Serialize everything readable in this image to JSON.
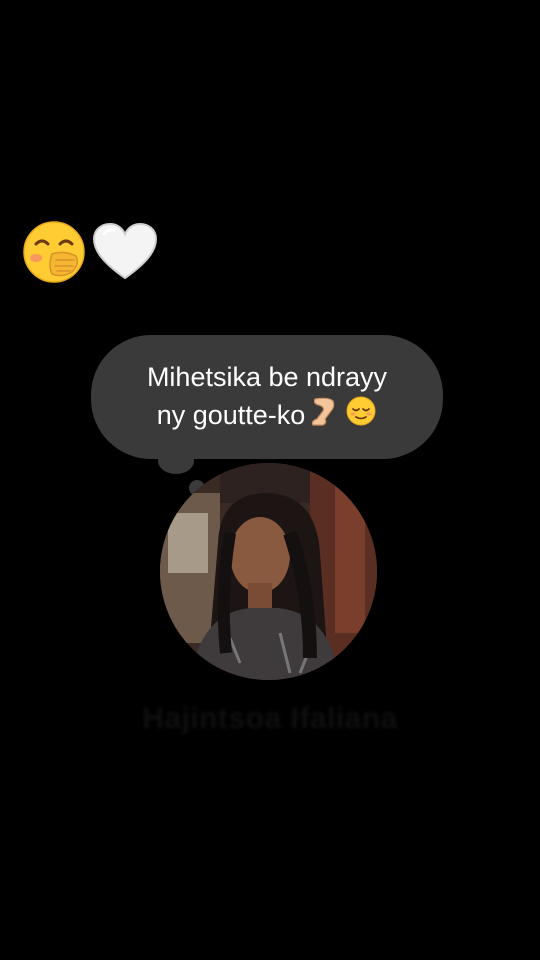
{
  "story": {
    "reaction_emojis": [
      "hand-over-mouth-emoji",
      "white-heart-emoji"
    ],
    "note": {
      "line1": "Mihetsika be ndrayy",
      "line2_text": "ny goutte-ko",
      "line2_emojis": [
        "leg-emoji",
        "relieved-face-emoji"
      ]
    },
    "profile": {
      "username": "Hajintsoa Ifaliana"
    }
  },
  "colors": {
    "background": "#000000",
    "bubble": "#3a3a3a",
    "text": "#ffffff",
    "username": "#0f0f0f"
  }
}
